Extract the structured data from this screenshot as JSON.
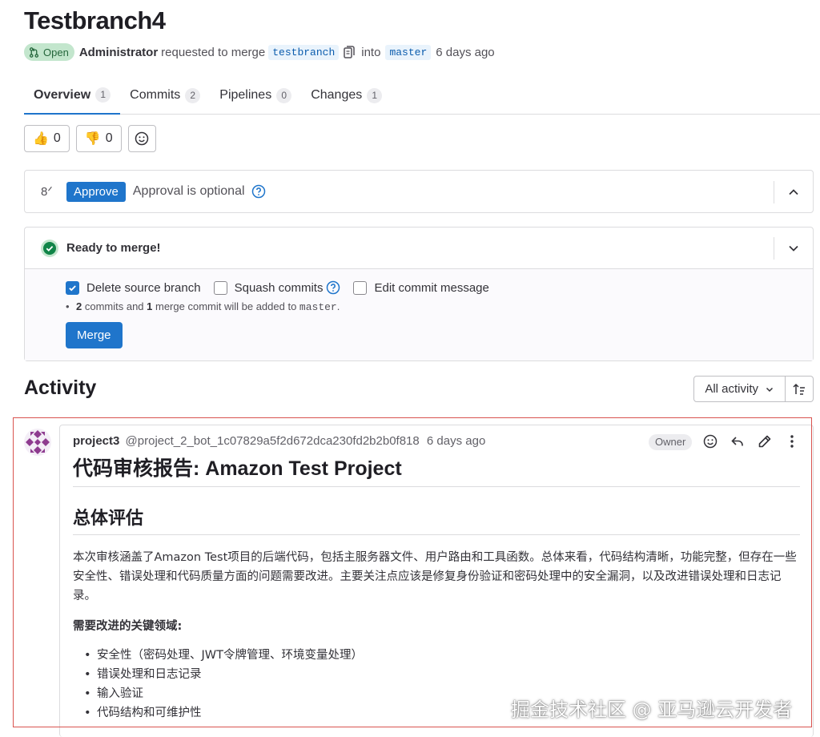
{
  "merge_request": {
    "title": "Testbranch4",
    "status": "Open",
    "author": "Administrator",
    "action_text": "requested to merge",
    "source_branch": "testbranch",
    "into_text": "into",
    "target_branch": "master",
    "time_ago": "6 days ago"
  },
  "tabs": [
    {
      "label": "Overview",
      "count": "1"
    },
    {
      "label": "Commits",
      "count": "2"
    },
    {
      "label": "Pipelines",
      "count": "0"
    },
    {
      "label": "Changes",
      "count": "1"
    }
  ],
  "reactions": {
    "thumbs_up": {
      "emoji": "👍",
      "count": "0"
    },
    "thumbs_down": {
      "emoji": "👎",
      "count": "0"
    }
  },
  "approval": {
    "approver_glyph": "8ᐟ",
    "button": "Approve",
    "text": "Approval is optional"
  },
  "merge": {
    "status_text": "Ready to merge!",
    "options": [
      {
        "label": "Delete source branch",
        "checked": true
      },
      {
        "label": "Squash commits",
        "checked": false
      },
      {
        "label": "Edit commit message",
        "checked": false
      }
    ],
    "note_commits": "2",
    "note_commits_text": " commits and ",
    "note_merge": "1",
    "note_merge_text": " merge commit will be added to ",
    "note_branch": "master",
    "note_end": ".",
    "button": "Merge"
  },
  "activity": {
    "title": "Activity",
    "filter": "All activity"
  },
  "comment": {
    "author": "project3",
    "handle": "@project_2_bot_1c07829a5f2d672dca230fd2b2b0f818",
    "time_ago": "6 days ago",
    "role": "Owner",
    "h1": "代码审核报告: Amazon Test Project",
    "h2": "总体评估",
    "paragraph": "本次审核涵盖了Amazon Test项目的后端代码，包括主服务器文件、用户路由和工具函数。总体来看，代码结构清晰，功能完整，但存在一些安全性、错误处理和代码质量方面的问题需要改进。主要关注点应该是修复身份验证和密码处理中的安全漏洞，以及改进错误处理和日志记录。",
    "key_areas_title": "需要改进的关键领域:",
    "key_areas": [
      "安全性（密码处理、JWT令牌管理、环境变量处理）",
      "错误处理和日志记录",
      "输入验证",
      "代码结构和可维护性"
    ]
  },
  "watermark": "掘金技术社区 @ 亚马逊云开发者",
  "colors": {
    "primary": "#1f75cb",
    "success": "#108548",
    "open_badge_bg": "#c3e6cd",
    "highlight_border": "#d9534f"
  }
}
